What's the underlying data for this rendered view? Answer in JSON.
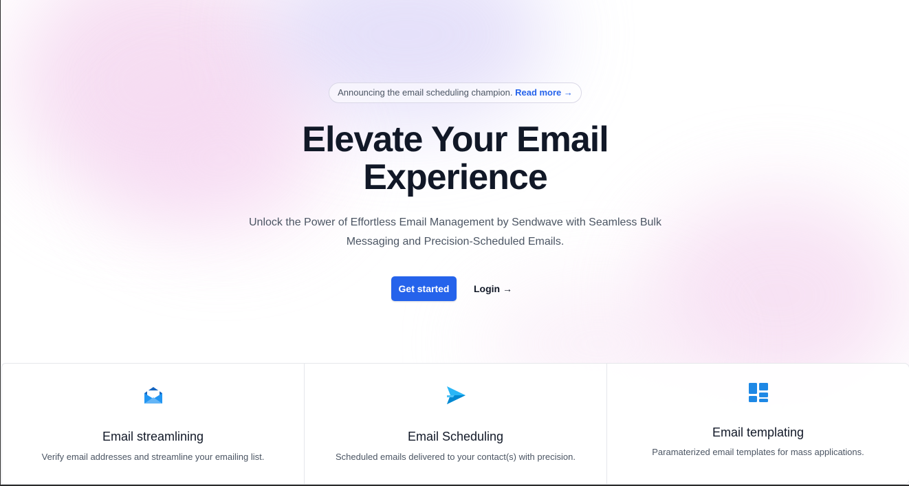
{
  "announcement": {
    "text": "Announcing the email scheduling champion.",
    "link_label": "Read more →"
  },
  "hero": {
    "title": "Elevate Your Email Experience",
    "subtitle": "Unlock the Power of Effortless Email Management by Sendwave with Seamless Bulk Messaging and Precision-Scheduled Emails.",
    "primary_button": "Get started",
    "secondary_button": "Login →"
  },
  "features": [
    {
      "icon": "envelope-open-icon",
      "title": "Email streamlining",
      "description": "Verify email addresses and streamline your emailing list."
    },
    {
      "icon": "send-icon",
      "title": "Email Scheduling",
      "description": "Scheduled emails delivered to your contact(s) with precision."
    },
    {
      "icon": "template-grid-icon",
      "title": "Email templating",
      "description": "Paramaterized email templates for mass applications."
    }
  ],
  "colors": {
    "accent": "#2563eb",
    "heading": "#111827",
    "body_text": "#4b5563"
  }
}
